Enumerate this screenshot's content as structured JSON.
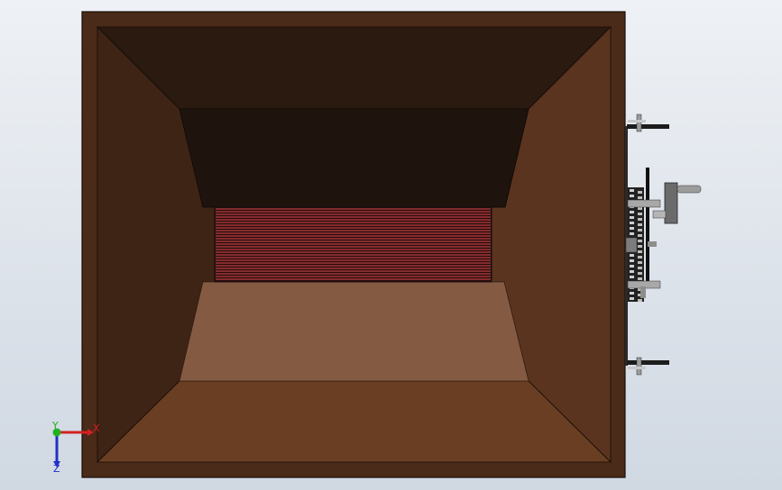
{
  "viewport": {
    "background_top": "#eef1f5",
    "background_bottom": "#d0d8e2"
  },
  "model": {
    "frame_color": "#4a2a18",
    "top_panel_color": "#2b1a10",
    "back_wall_color": "#1e140d",
    "left_panel_color": "#3d2415",
    "right_panel_color": "#5a341f",
    "bottom_panel_color": "#6a3e22",
    "floor_color": "#855a43",
    "heater_coil_color": "#b83e42"
  },
  "triad": {
    "x_label": "X",
    "y_label": "Y",
    "z_label": "Z",
    "x_color": "#d42020",
    "y_color": "#20b020",
    "z_color": "#2030c8"
  }
}
